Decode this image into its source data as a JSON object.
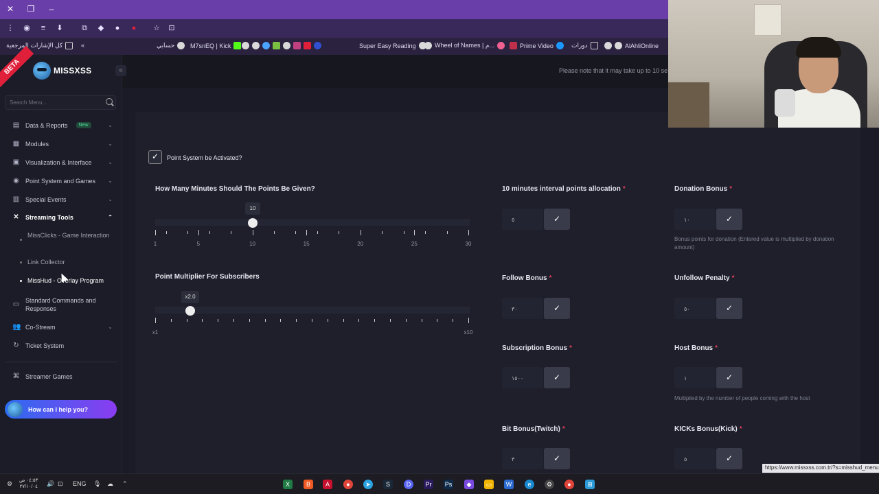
{
  "browser": {
    "bookmarks": [
      {
        "label": "كل الإشارات المرجعية"
      },
      {
        "label": "حسابي"
      },
      {
        "label": "M7snEQ | Kick"
      },
      {
        "label": "Super Easy Reading"
      },
      {
        "label": "Wheel of Names | م..."
      },
      {
        "label": "Prime Video"
      },
      {
        "label": "دورات"
      },
      {
        "label": "AlAhliOnline"
      }
    ]
  },
  "app": {
    "logo_text": "MISSXSS",
    "beta_label": "BETA",
    "notice": "Please note that it may take up to 10 se"
  },
  "sidebar": {
    "search_placeholder": "Search Menu...",
    "items": [
      {
        "label": "Data & Reports",
        "badge": "New"
      },
      {
        "label": "Modules"
      },
      {
        "label": "Visualization & Interface"
      },
      {
        "label": "Point System and Games"
      },
      {
        "label": "Special Events"
      },
      {
        "label": "Streaming Tools"
      },
      {
        "label": "Standard Commands and Responses"
      },
      {
        "label": "Co-Stream"
      },
      {
        "label": "Ticket System"
      },
      {
        "label": "Streamer Games"
      }
    ],
    "subitems": [
      {
        "label": "MissClicks - Game Interaction"
      },
      {
        "label": "Link Collector"
      },
      {
        "label": "MissHud - Overlay Program"
      }
    ],
    "help_label": "How can I help you?"
  },
  "main": {
    "activate_label": "Point System be Activated?",
    "minutes_label": "How Many Minutes Should The Points Be Given?",
    "minutes_value": "10",
    "minutes_ticks": [
      "1",
      "5",
      "10",
      "15",
      "20",
      "25",
      "30"
    ],
    "multiplier_label": "Point Multiplier For Subscribers",
    "multiplier_value": "x2.0",
    "multiplier_min": "x1",
    "multiplier_max": "x10",
    "fields": {
      "interval": {
        "label": "10 minutes interval points allocation",
        "value": "٥"
      },
      "donation": {
        "label": "Donation Bonus",
        "value": "١٠",
        "hint": "Bonus points for donation (Entered value is multiplied by donation amount)"
      },
      "follow": {
        "label": "Follow Bonus",
        "value": "٣٠"
      },
      "unfollow": {
        "label": "Unfollow Penalty",
        "value": "٥٠"
      },
      "subscription": {
        "label": "Subscription Bonus",
        "value": "١٥٠٠"
      },
      "host": {
        "label": "Host Bonus",
        "value": "١",
        "hint": "Multiplied by the number of people coming with the host"
      },
      "bit": {
        "label": "Bit Bonus(Twitch)",
        "value": "٣"
      },
      "kicks": {
        "label": "KICKs Bonus(Kick)",
        "value": "٥"
      }
    }
  },
  "statusbar": {
    "url": "https://www.missxss.com.tr/?s=misshud_menu"
  },
  "taskbar": {
    "lang": "ENG",
    "time": "٠٤:٥٣ ص",
    "date": "٢٧/١٠/٠٤"
  }
}
